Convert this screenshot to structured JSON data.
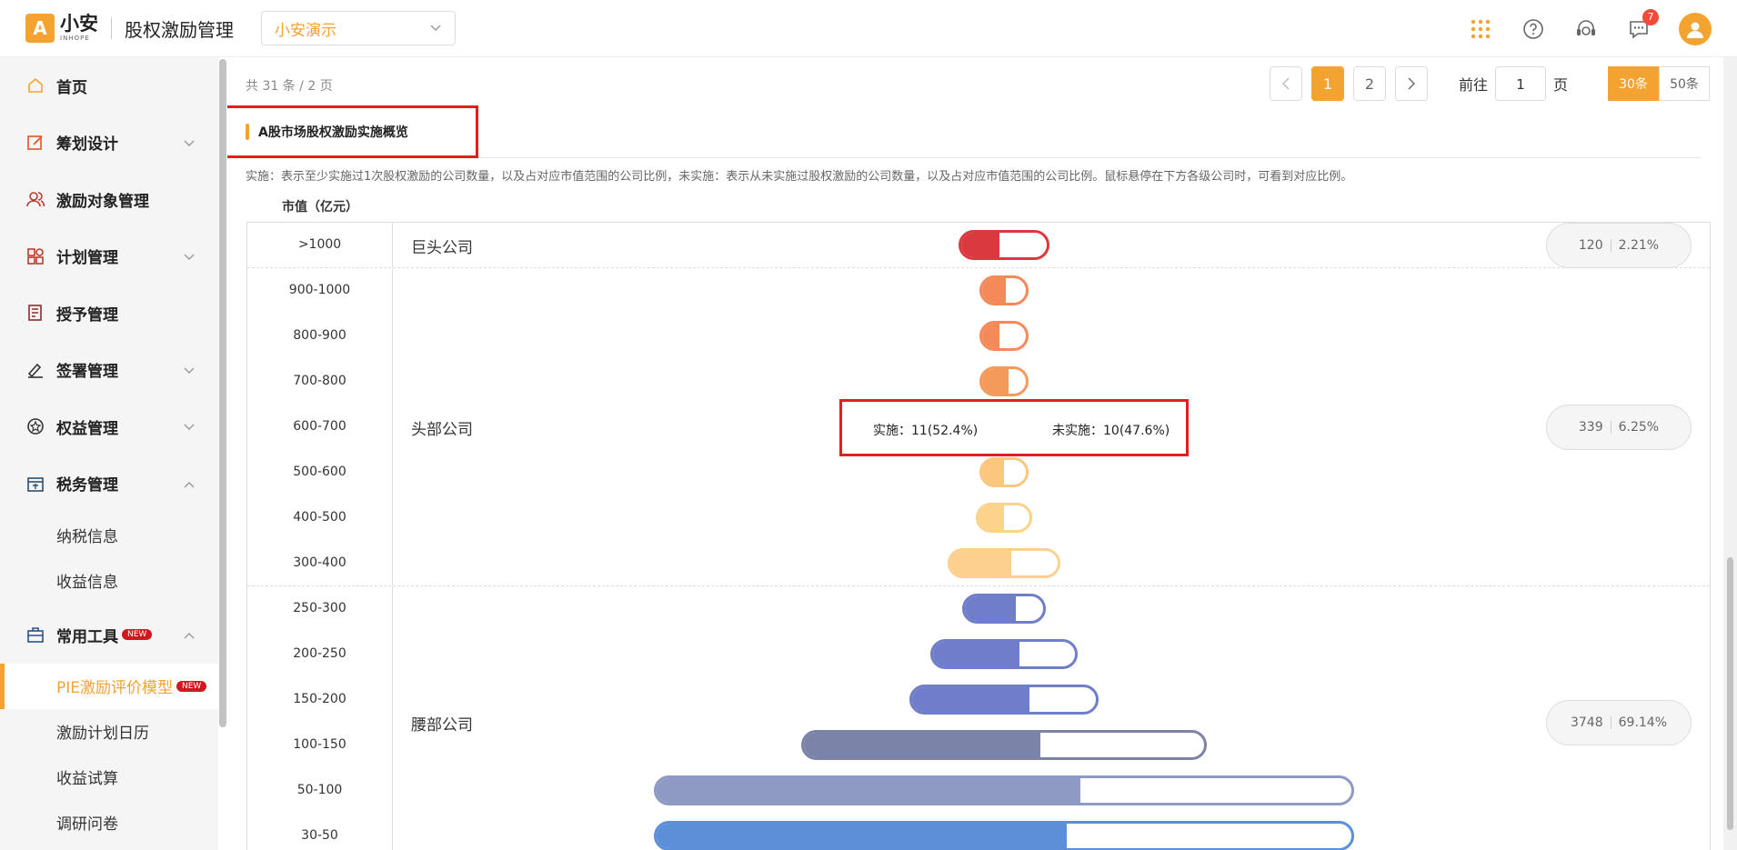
{
  "header": {
    "logo_cn": "小安",
    "logo_en": "INHOPE",
    "app_title": "股权激励管理",
    "company": "小安演示",
    "message_badge": "7"
  },
  "sidebar": {
    "items": [
      {
        "label": "首页",
        "icon": "home-icon"
      },
      {
        "label": "筹划设计",
        "icon": "edit-icon",
        "chevron": "down"
      },
      {
        "label": "激励对象管理",
        "icon": "users-icon"
      },
      {
        "label": "计划管理",
        "icon": "grid-icon",
        "chevron": "down"
      },
      {
        "label": "授予管理",
        "icon": "book-icon"
      },
      {
        "label": "签署管理",
        "icon": "sign-icon",
        "chevron": "down"
      },
      {
        "label": "权益管理",
        "icon": "badge-icon",
        "chevron": "down"
      },
      {
        "label": "税务管理",
        "icon": "tax-icon",
        "chevron": "up"
      }
    ],
    "tax_sub": [
      "纳税信息",
      "收益信息"
    ],
    "tools": {
      "label": "常用工具",
      "new_tag": "NEW",
      "icon": "toolbox-icon"
    },
    "tools_sub": [
      {
        "label": "PIE激励评价模型",
        "new_tag": "NEW",
        "active": true
      },
      {
        "label": "激励计划日历"
      },
      {
        "label": "收益试算"
      },
      {
        "label": "调研问卷"
      }
    ]
  },
  "pager": {
    "total": "共 31 条 / 2 页",
    "pages": [
      "1",
      "2"
    ],
    "current": "1",
    "goto_label": "前往",
    "goto_value": "1",
    "page_unit": "页",
    "sizes": [
      "30条",
      "50条"
    ],
    "active_size": "30条"
  },
  "section": {
    "title": "A股市场股权激励实施概览",
    "description": "实施：表示至少实施过1次股权激励的公司数量，以及占对应市值范围的公司比例，未实施：表示从未实施过股权激励的公司数量，以及占对应市值范围的公司比例。鼠标悬停在下方各级公司时，可看到对应比例。",
    "cap_label": "市值（亿元）"
  },
  "tiers": [
    {
      "name": "巨头公司",
      "count": "120",
      "ratio": "2.21%"
    },
    {
      "name": "头部公司",
      "count": "339",
      "ratio": "6.25%"
    },
    {
      "name": "腰部公司",
      "count": "3748",
      "ratio": "69.14%"
    }
  ],
  "rows": [
    {
      "range": ">1000",
      "tier": 0,
      "width": 0.13,
      "implemented": 0.45,
      "color": "#d9393f"
    },
    {
      "range": "900-1000",
      "tier": 1,
      "width": 0.07,
      "implemented": 0.55,
      "color": "#f4895a"
    },
    {
      "range": "800-900",
      "tier": 1,
      "width": 0.07,
      "implemented": 0.4,
      "color": "#f4895a"
    },
    {
      "range": "700-800",
      "tier": 1,
      "width": 0.07,
      "implemented": 0.6,
      "color": "#f49a5a"
    },
    {
      "range": "600-700",
      "tier": 1,
      "width": 0.07,
      "implemented": 0.524,
      "color": "#f8b070"
    },
    {
      "range": "500-600",
      "tier": 1,
      "width": 0.07,
      "implemented": 0.5,
      "color": "#fbc77f"
    },
    {
      "range": "400-500",
      "tier": 1,
      "width": 0.08,
      "implemented": 0.5,
      "color": "#fdd28a"
    },
    {
      "range": "300-400",
      "tier": 1,
      "width": 0.16,
      "implemented": 0.57,
      "color": "#fdd08f"
    },
    {
      "range": "250-300",
      "tier": 2,
      "width": 0.12,
      "implemented": 0.65,
      "color": "#6e7ec8"
    },
    {
      "range": "200-250",
      "tier": 2,
      "width": 0.21,
      "implemented": 0.61,
      "color": "#6e7ec8"
    },
    {
      "range": "150-200",
      "tier": 2,
      "width": 0.27,
      "implemented": 0.64,
      "color": "#6e7ec8"
    },
    {
      "range": "100-150",
      "tier": 2,
      "width": 0.58,
      "implemented": 0.59,
      "color": "#7b83a8"
    },
    {
      "range": "50-100",
      "tier": 2,
      "width": 1.0,
      "implemented": 0.61,
      "color": "#8f9ac4"
    },
    {
      "range": "30-50",
      "tier": 2,
      "width": 1.0,
      "implemented": 0.59,
      "color": "#5b8fd8"
    }
  ],
  "tooltip": {
    "implemented": "实施：11(52.4%)",
    "not_implemented": "未实施：10(47.6%)"
  }
}
